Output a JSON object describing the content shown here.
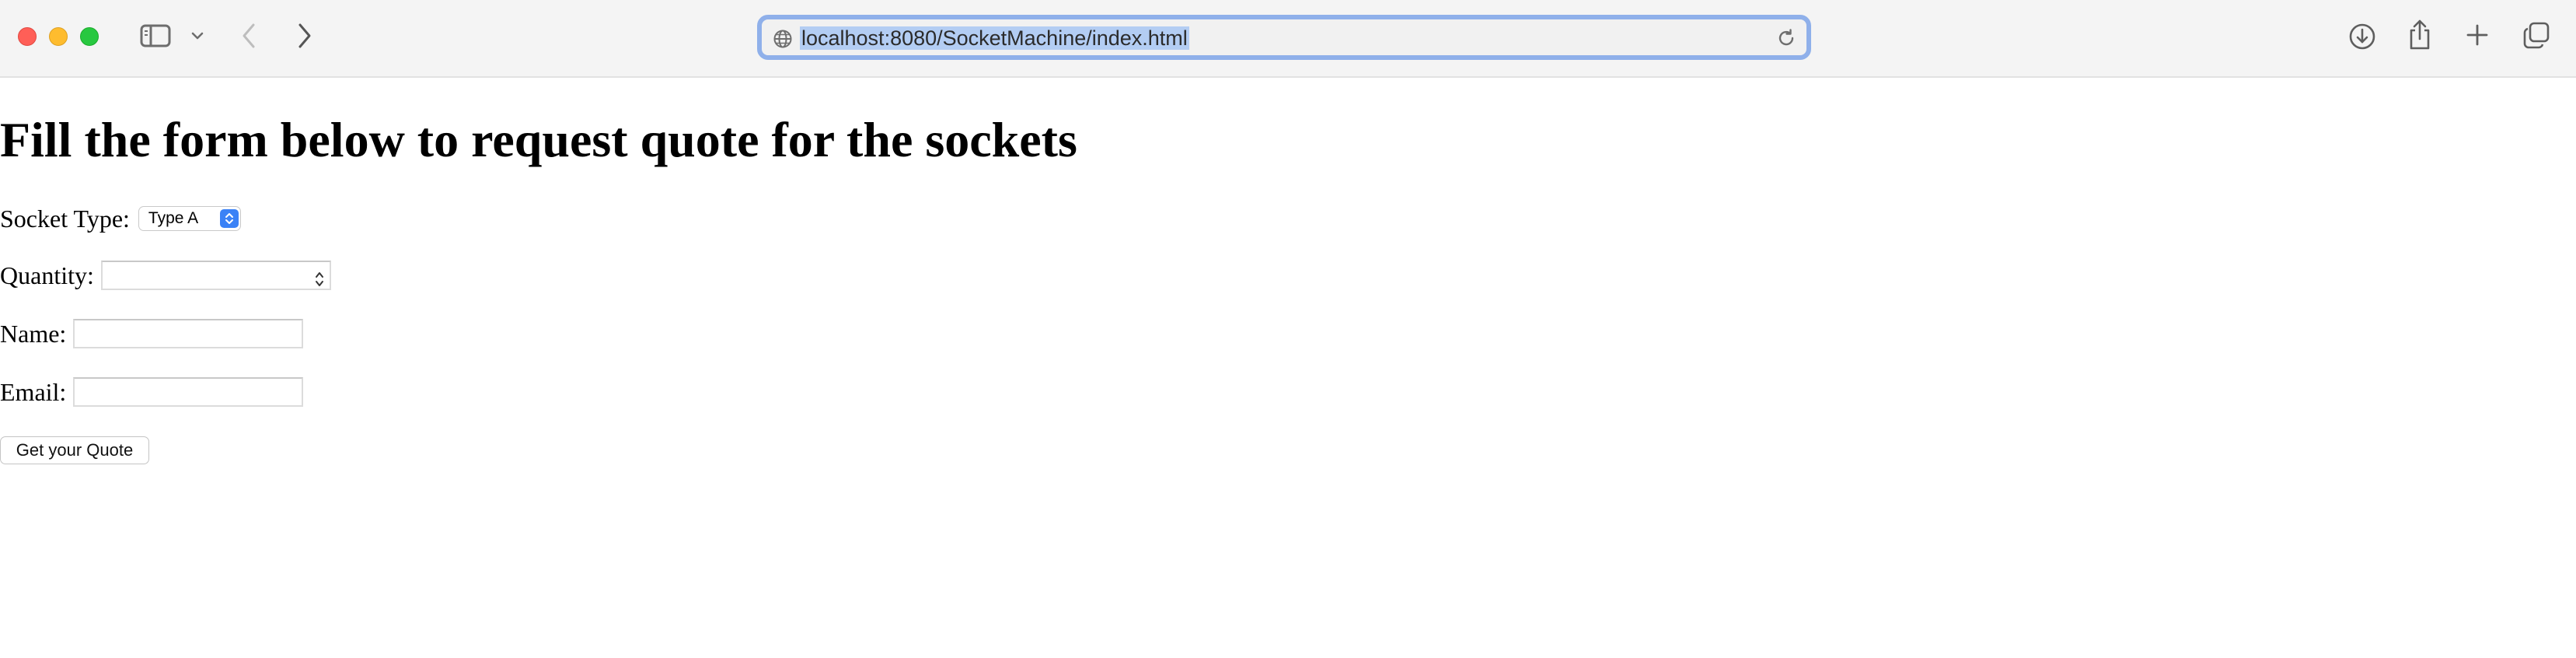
{
  "browser": {
    "url": "localhost:8080/SocketMachine/index.html",
    "icons": {
      "sidebar": "sidebar-icon",
      "sidebar_menu": "chevron-down-icon",
      "back": "chevron-left-icon",
      "forward": "chevron-right-icon",
      "site": "globe-icon",
      "reload": "reload-icon",
      "downloads": "download-icon",
      "share": "share-icon",
      "new_tab": "plus-icon",
      "tab_overview": "tabs-icon"
    },
    "colors": {
      "close": "#ff5f57",
      "minimize": "#febc2e",
      "maximize": "#28c840",
      "focus_ring": "#8fb0ea",
      "url_selection": "#b3cdf3"
    }
  },
  "page": {
    "title": "Fill the form below to request quote for the sockets",
    "form": {
      "socket_type": {
        "label": "Socket Type:",
        "selected": "Type A"
      },
      "quantity": {
        "label": "Quantity:",
        "value": ""
      },
      "name": {
        "label": "Name:",
        "value": ""
      },
      "email": {
        "label": "Email:",
        "value": ""
      },
      "submit_label": "Get your Quote"
    }
  }
}
